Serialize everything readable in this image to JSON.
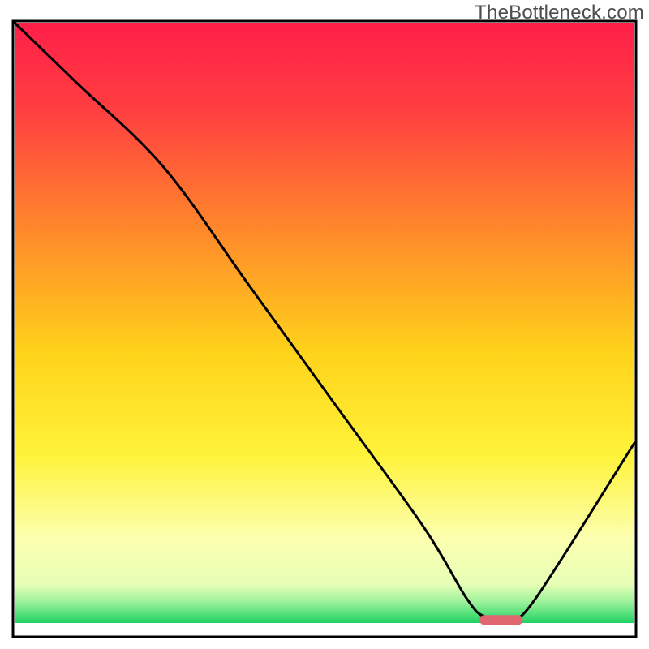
{
  "watermark": "TheBottleneck.com",
  "chart_data": {
    "type": "line",
    "title": "",
    "xlabel": "",
    "ylabel": "",
    "xlim": [
      0,
      100
    ],
    "ylim": [
      0,
      100
    ],
    "grid": false,
    "background_gradient": [
      {
        "offset": 0.0,
        "color": "#ff1f49"
      },
      {
        "offset": 0.15,
        "color": "#ff4040"
      },
      {
        "offset": 0.35,
        "color": "#ff8a2a"
      },
      {
        "offset": 0.55,
        "color": "#ffd31a"
      },
      {
        "offset": 0.72,
        "color": "#fff33a"
      },
      {
        "offset": 0.86,
        "color": "#fcffb0"
      },
      {
        "offset": 0.935,
        "color": "#e7ffb6"
      },
      {
        "offset": 0.965,
        "color": "#9cf29a"
      },
      {
        "offset": 1.0,
        "color": "#1fd163"
      }
    ],
    "series": [
      {
        "name": "bottleneck-curve",
        "color": "#000000",
        "x": [
          0,
          10,
          24,
          38,
          52,
          66,
          73,
          76,
          80,
          84,
          100
        ],
        "y": [
          100,
          90,
          76,
          56,
          36,
          16,
          4,
          1,
          1,
          4,
          30
        ]
      }
    ],
    "markers": [
      {
        "name": "optimal-range-bar",
        "shape": "rounded-bar",
        "color": "#e06670",
        "x_start": 75,
        "x_end": 82,
        "y": 0.5,
        "thickness": 12
      }
    ]
  }
}
